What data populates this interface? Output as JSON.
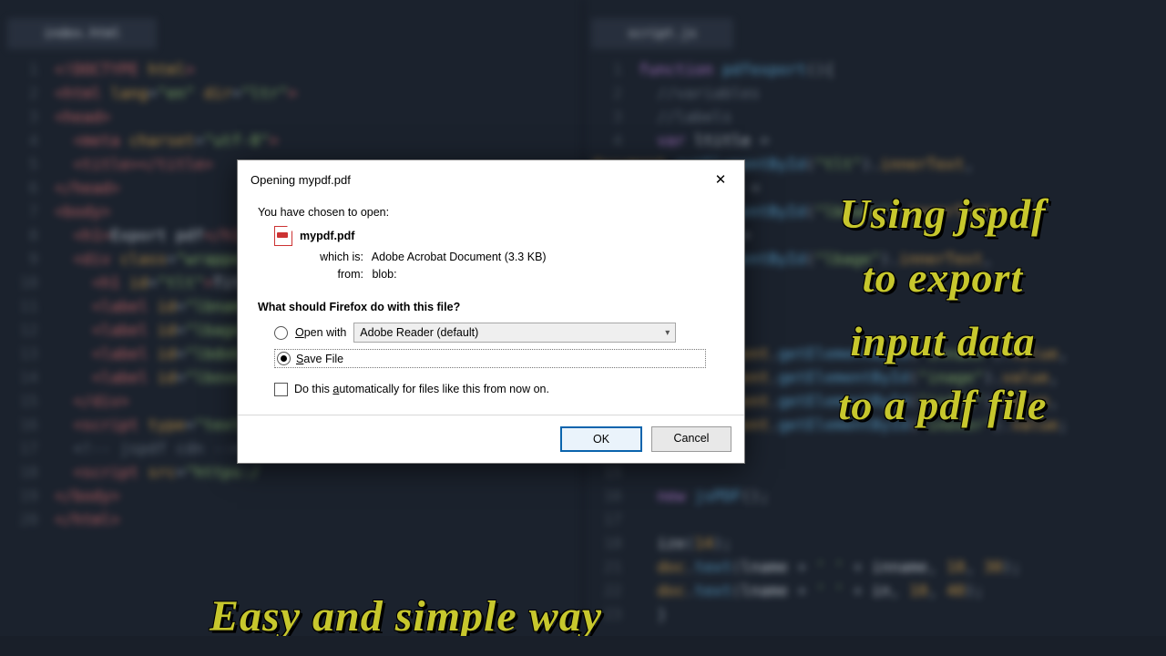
{
  "bg": {
    "leftTab": "index.html",
    "rightTab": "script.js"
  },
  "captions": {
    "right": "Using jspdf\nto export\ninput data\nto a pdf file",
    "bottom": "Easy and simple way"
  },
  "dialog": {
    "title": "Opening mypdf.pdf",
    "lead": "You have chosen to open:",
    "filename": "mypdf.pdf",
    "whichIsLabel": "which is:",
    "whichIsValue": "Adobe Acrobat Document (3.3 KB)",
    "fromLabel": "from:",
    "fromValue": "blob:",
    "question": "What should Firefox do with this file?",
    "openWithPrefix": "O",
    "openWithRest": "pen with",
    "openWithApp": "Adobe Reader  (default)",
    "saveFilePrefix": "S",
    "saveFileRest": "ave File",
    "autoPrefix": "Do this ",
    "autoUnderline": "a",
    "autoRest": "utomatically for files like this from now on.",
    "ok": "OK",
    "cancel": "Cancel"
  }
}
